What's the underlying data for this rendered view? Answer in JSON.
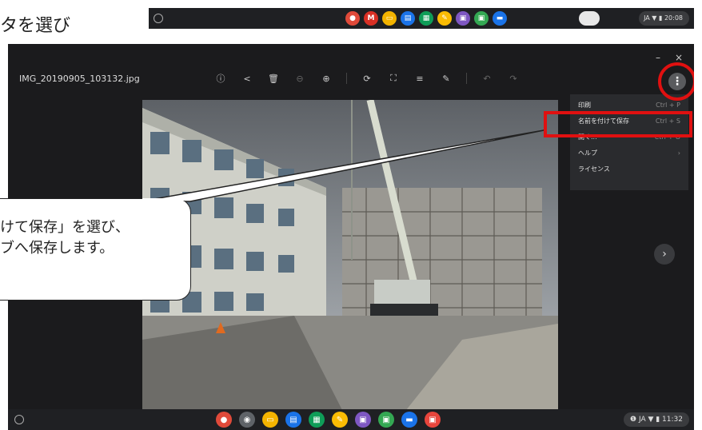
{
  "top_text": "タを選び",
  "mini_shelf": {
    "status": "JA ▼ ▮ 20:08",
    "apps": [
      {
        "name": "chrome-icon",
        "color": "#e04a3a",
        "glyph": "●"
      },
      {
        "name": "gmail-icon",
        "color": "#d93025",
        "glyph": "M"
      },
      {
        "name": "slides-icon",
        "color": "#f4b400",
        "glyph": "▭"
      },
      {
        "name": "docs-icon",
        "color": "#1a73e8",
        "glyph": "▤"
      },
      {
        "name": "sheets-icon",
        "color": "#0f9d58",
        "glyph": "▦"
      },
      {
        "name": "keep-icon",
        "color": "#fbbc04",
        "glyph": "✎"
      },
      {
        "name": "classroom-icon",
        "color": "#7e57c2",
        "glyph": "▣"
      },
      {
        "name": "meet-icon",
        "color": "#34a853",
        "glyph": "▣"
      },
      {
        "name": "files-icon",
        "color": "#1a73e8",
        "glyph": "▬"
      }
    ]
  },
  "viewer": {
    "filename": "IMG_20190905_103132.jpg",
    "window_controls": {
      "minimize": "–",
      "close": "×"
    },
    "toolbar": [
      {
        "name": "info-icon",
        "glyph": "ⓘ",
        "dim": false
      },
      {
        "name": "share-icon",
        "glyph": "<",
        "dim": false
      },
      {
        "name": "delete-icon",
        "glyph": "🗑",
        "dim": false
      },
      {
        "name": "zoom-out-icon",
        "glyph": "⊖",
        "dim": true
      },
      {
        "name": "zoom-in-icon",
        "glyph": "⊕",
        "dim": false
      },
      {
        "name": "rotate-icon",
        "glyph": "⟳",
        "dim": false
      },
      {
        "name": "crop-icon",
        "glyph": "⛶",
        "dim": false
      },
      {
        "name": "adjust-icon",
        "glyph": "≡",
        "dim": false
      },
      {
        "name": "annotate-icon",
        "glyph": "✎",
        "dim": false
      },
      {
        "name": "undo-icon",
        "glyph": "↶",
        "dim": true
      },
      {
        "name": "redo-icon",
        "glyph": "↷",
        "dim": true
      }
    ],
    "menu_button_glyph": "⋮",
    "next_glyph": "›",
    "menu": [
      {
        "label": "印刷",
        "shortcut": "Ctrl + P"
      },
      {
        "label": "名前を付けて保存",
        "shortcut": "Ctrl + S"
      },
      {
        "label": "開く...",
        "shortcut": "Ctrl + O"
      },
      {
        "label": "ヘルプ",
        "shortcut": "›"
      },
      {
        "label": "ライセンス",
        "shortcut": ""
      }
    ]
  },
  "shelf": {
    "status": "❶ JA ▼ ▮ 11:32",
    "apps": [
      {
        "name": "chrome-icon",
        "color": "#e04a3a",
        "glyph": "●"
      },
      {
        "name": "camera-icon",
        "color": "#5f6368",
        "glyph": "◉"
      },
      {
        "name": "slides-icon",
        "color": "#f4b400",
        "glyph": "▭"
      },
      {
        "name": "docs-icon",
        "color": "#1a73e8",
        "glyph": "▤"
      },
      {
        "name": "sheets-icon",
        "color": "#0f9d58",
        "glyph": "▦"
      },
      {
        "name": "keep-icon",
        "color": "#fbbc04",
        "glyph": "✎"
      },
      {
        "name": "classroom-icon",
        "color": "#7e57c2",
        "glyph": "▣"
      },
      {
        "name": "meet-icon",
        "color": "#34a853",
        "glyph": "▣"
      },
      {
        "name": "files-icon",
        "color": "#1a73e8",
        "glyph": "▬"
      },
      {
        "name": "gallery-icon",
        "color": "#e8453c",
        "glyph": "▣"
      }
    ]
  },
  "callout": {
    "line1": "けて保存」を選び、",
    "line2": "ブへ保存します。"
  }
}
